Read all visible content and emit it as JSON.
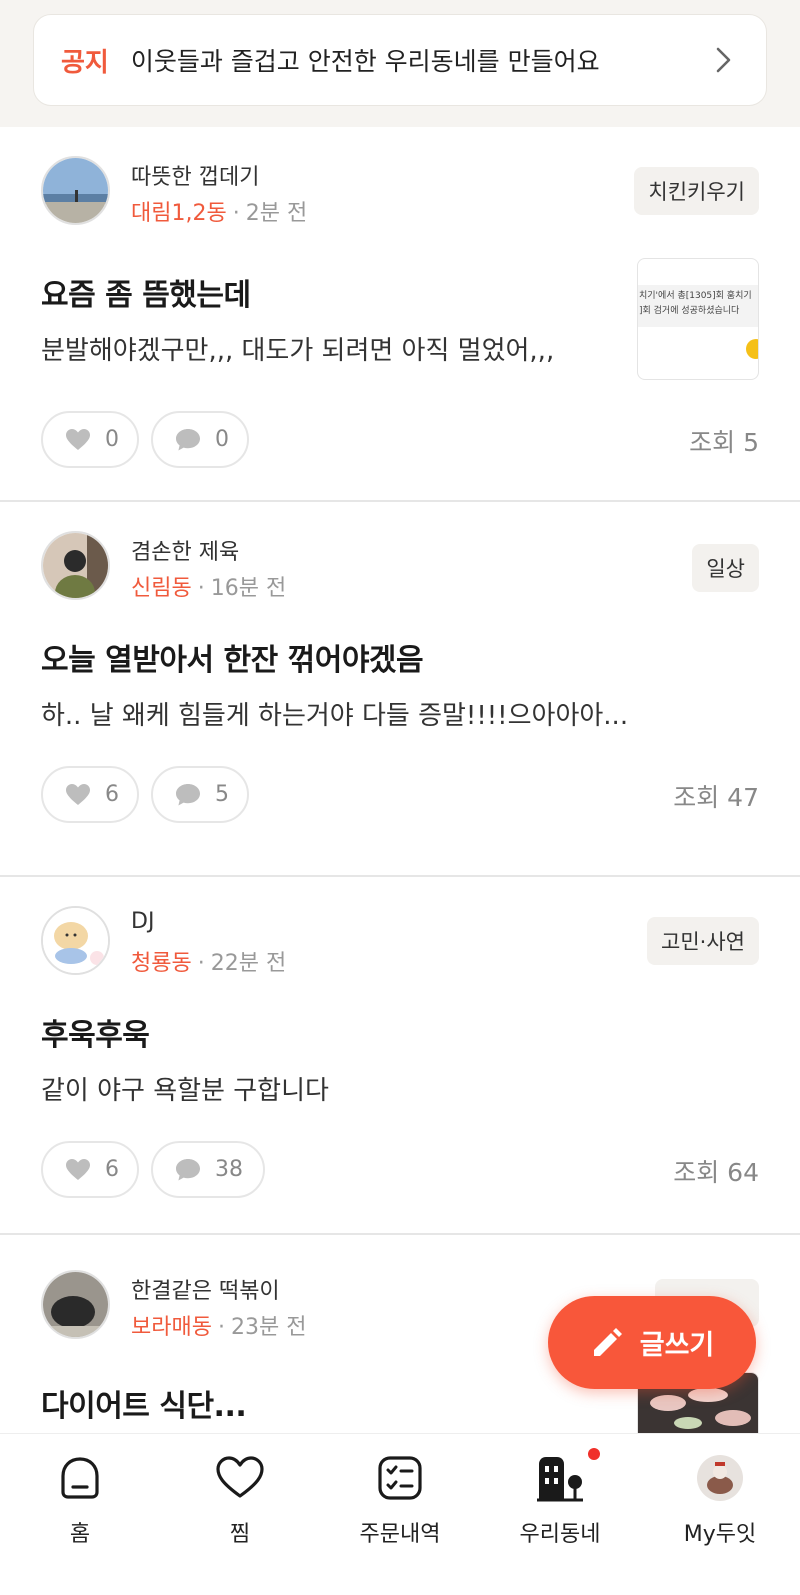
{
  "notice": {
    "tag": "공지",
    "text": "이웃들과 즐겁고 안전한 우리동네를 만들어요"
  },
  "posts": [
    {
      "nickname": "따뜻한 껍데기",
      "town": "대림1,2동",
      "time": "2분 전",
      "category": "치킨키우기",
      "title": "요즘 좀 뜸했는데",
      "body": "분발해야겠구만,,, 대도가 되려면 아직 멀었어,,,",
      "likes": "0",
      "comments": "0",
      "views": "조회 5",
      "thumb_lines": [
        "치기'에서 총[1305]회 훔치기",
        "]회 검거에 성공하셨습니다"
      ]
    },
    {
      "nickname": "겸손한 제육",
      "town": "신림동",
      "time": "16분 전",
      "category": "일상",
      "title": "오늘 열받아서 한잔 꺾어야겠음",
      "body": "하.. 날 왜케 힘들게 하는거야 다들 증말!!!!으아아아...",
      "likes": "6",
      "comments": "5",
      "views": "조회 47"
    },
    {
      "nickname": "DJ",
      "town": "청룡동",
      "time": "22분 전",
      "category": "고민·사연",
      "title": "후욱후욱",
      "body": "같이 야구 욕할분 구합니다",
      "likes": "6",
      "comments": "38",
      "views": "조회 64"
    },
    {
      "nickname": "한결같은 떡볶이",
      "town": "보라매동",
      "time": "23분 전",
      "title": "다이어트 식단..."
    }
  ],
  "fab": {
    "label": "글쓰기"
  },
  "tabs": [
    {
      "label": "홈",
      "icon": "home-icon"
    },
    {
      "label": "찜",
      "icon": "heart-icon"
    },
    {
      "label": "주문내역",
      "icon": "order-list-icon"
    },
    {
      "label": "우리동네",
      "icon": "neighborhood-icon"
    },
    {
      "label": "My두잇",
      "icon": "profile-avatar"
    }
  ],
  "colors": {
    "accent": "#f05a3c",
    "fab": "#f8573a",
    "badge": "#f0302a"
  }
}
